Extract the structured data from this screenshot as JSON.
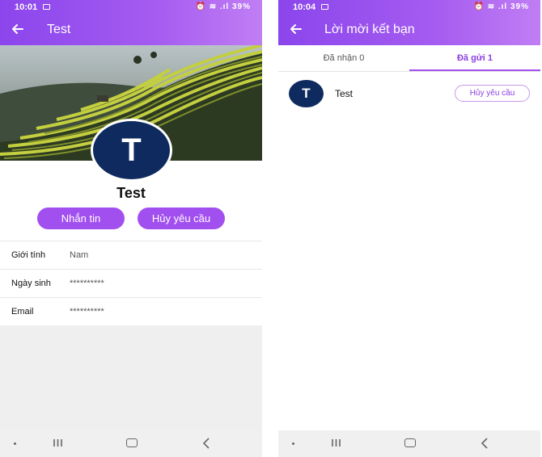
{
  "colors": {
    "primary": "#a24ff0",
    "appbar_start": "#8b45ec",
    "appbar_end": "#c07ef4",
    "avatar_bg": "#0e2a5e",
    "tab_active": "#8b3fe0"
  },
  "profile_screen": {
    "status": {
      "time": "10:01",
      "battery": "39%"
    },
    "appbar": {
      "back_icon": "arrow-left-icon",
      "title": "Test"
    },
    "avatar_initial": "T",
    "name": "Test",
    "buttons": {
      "message": "Nhắn tin",
      "cancel_request": "Hủy yêu cầu"
    },
    "info": [
      {
        "label": "Giới tính",
        "value": "Nam"
      },
      {
        "label": "Ngày sinh",
        "value": "**********"
      },
      {
        "label": "Email",
        "value": "**********"
      }
    ]
  },
  "requests_screen": {
    "status": {
      "time": "10:04",
      "battery": "39%"
    },
    "appbar": {
      "back_icon": "arrow-left-icon",
      "title": "Lời mời kết bạn"
    },
    "tabs": [
      {
        "label": "Đã nhận 0",
        "active": false
      },
      {
        "label": "Đã gửi 1",
        "active": true
      }
    ],
    "requests": [
      {
        "initial": "T",
        "name": "Test",
        "action": "Hủy yêu cầu"
      }
    ]
  }
}
